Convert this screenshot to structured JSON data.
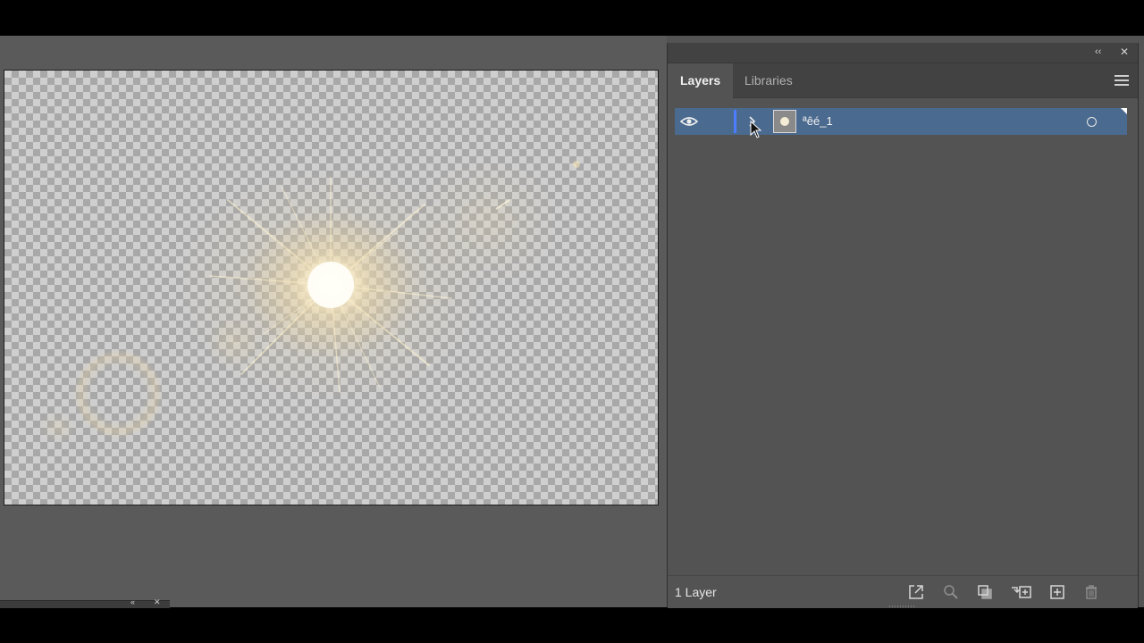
{
  "canvas": {
    "artboard_label": ""
  },
  "panel": {
    "collapse_icon": "double-chevron-left-icon",
    "close_icon": "close-icon",
    "tabs": [
      {
        "label": "Layers",
        "active": true
      },
      {
        "label": "Libraries",
        "active": false
      }
    ],
    "menu_icon": "hamburger-menu-icon",
    "layers": [
      {
        "name": "ªêé_1",
        "visible": true,
        "selected": true,
        "color": "#4d7dff"
      }
    ],
    "footer": {
      "count_label": "1 Layer",
      "icons": [
        "export-icon",
        "locate-object-icon",
        "make-clipping-mask-icon",
        "create-sublayer-icon",
        "create-layer-icon",
        "delete-icon"
      ]
    }
  },
  "colors": {
    "selection": "#4b6a8f",
    "layer_color": "#4d7dff",
    "panel_bg": "#535353",
    "tabbar_bg": "#424242"
  }
}
